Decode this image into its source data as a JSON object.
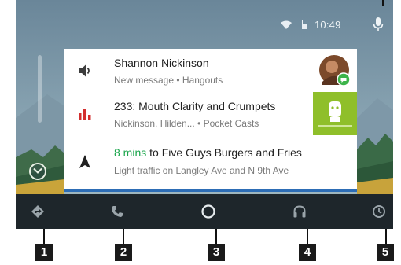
{
  "status_bar": {
    "time": "10:49",
    "icons": [
      "wifi-icon",
      "battery-icon",
      "microphone-icon"
    ]
  },
  "cards": [
    {
      "icon": "volume-icon",
      "title": "Shannon Nickinson",
      "subtitle": "New message • Hangouts",
      "thumbnail": "contact-photo"
    },
    {
      "icon": "equalizer-icon",
      "title": "233: Mouth Clarity and Crumpets",
      "subtitle": "Nickinson, Hilden... • Pocket Casts",
      "thumbnail": "podcast-artwork",
      "accent_color": "#d32f2f"
    },
    {
      "icon": "navigation-arrow-icon",
      "title_highlight": "8 mins",
      "title_rest": " to Five Guys Burgers and Fries",
      "subtitle": "Light traffic on Langley Ave and N 9th Ave",
      "highlight_color": "#1aa54b"
    }
  ],
  "nav_bar": {
    "items": [
      {
        "icon": "directions-icon",
        "callout": "1"
      },
      {
        "icon": "phone-icon",
        "callout": "2"
      },
      {
        "icon": "home-circle-icon",
        "callout": "3"
      },
      {
        "icon": "headphones-icon",
        "callout": "4"
      },
      {
        "icon": "recent-icon",
        "callout": "5"
      }
    ]
  },
  "colors": {
    "navbar": "#1e262b",
    "card": "#ffffff",
    "highlight": "#1aa54b",
    "progress": "#2d6db5"
  }
}
